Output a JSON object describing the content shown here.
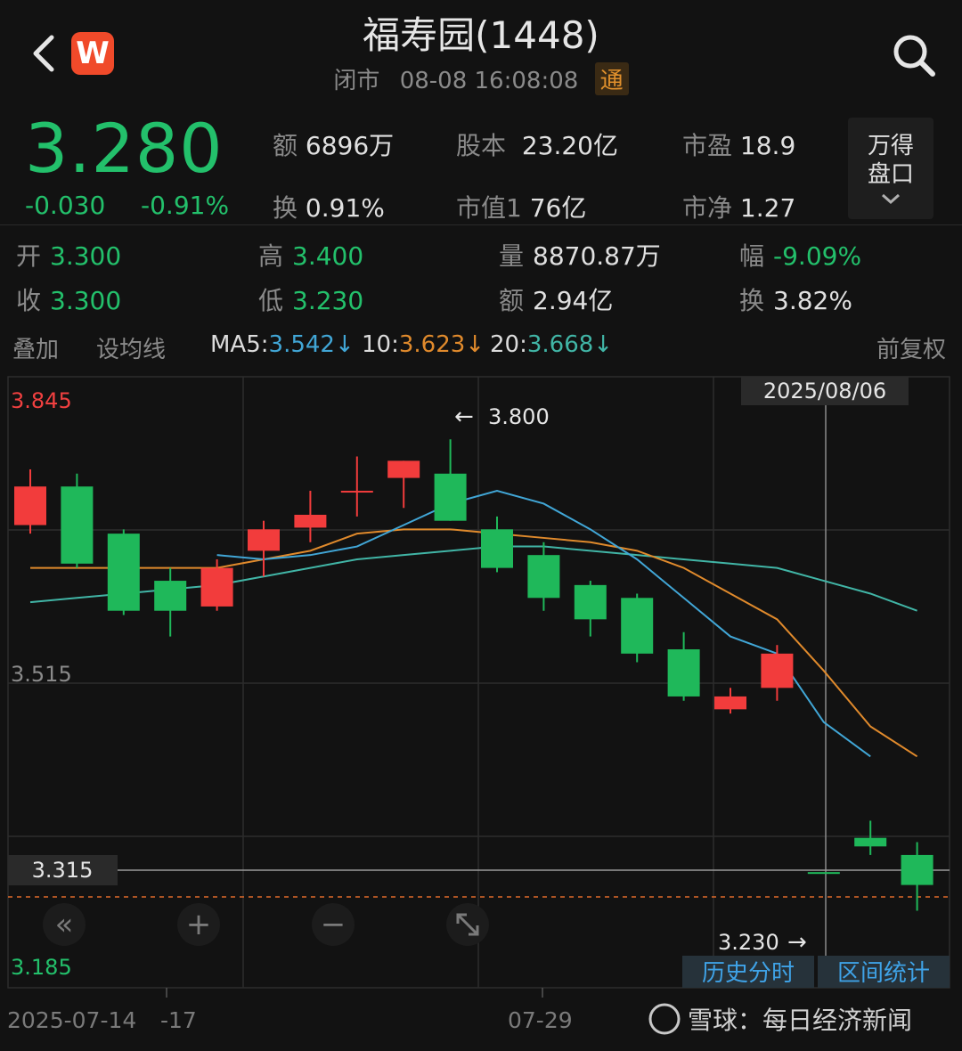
{
  "header": {
    "back_icon": "chevron-left-icon",
    "logo_letter": "W",
    "title": "福寿园(1448)",
    "status": "闭市",
    "datetime": "08-08 16:08:08",
    "badge": "通",
    "search_icon": "search-icon"
  },
  "quote": {
    "last_price": "3.280",
    "change": "-0.030",
    "change_pct": "-0.91%",
    "amount_label": "额",
    "amount": "6896万",
    "share_cap_label": "股本",
    "share_cap": "23.20亿",
    "pe_label": "市盈",
    "pe": "18.9",
    "turnover_label": "换",
    "turnover": "0.91%",
    "mkt_cap_label": "市值1",
    "mkt_cap": "76亿",
    "pb_label": "市净",
    "pb": "1.27",
    "pankou_line1": "万得",
    "pankou_line2": "盘口",
    "pankou_icon": "chevron-down-icon"
  },
  "day_stats": {
    "open_label": "开",
    "open": "3.300",
    "high_label": "高",
    "high": "3.400",
    "volume_label": "量",
    "volume": "8870.87万",
    "range_label": "幅",
    "range": "-9.09%",
    "close_label": "收",
    "close": "3.300",
    "low_label": "低",
    "low": "3.230",
    "amount_label": "额",
    "amount": "2.94亿",
    "turnover_label": "换",
    "turnover": "3.82%"
  },
  "indicators": {
    "overlay": "叠加",
    "set_ma": "设均线",
    "ma5_label": "MA5:",
    "ma5": "3.542↓",
    "ma10_label": "10:",
    "ma10": "3.623↓",
    "ma20_label": "20:",
    "ma20": "3.668↓",
    "adjust": "前复权"
  },
  "chart_controls": {
    "rewind": "«",
    "zoom_in": "+",
    "zoom_out": "−",
    "expand_icon": "expand-icon",
    "history_button": "历史分时",
    "range_stats_button": "区间统计"
  },
  "watermark": "雪球：每日经济新闻",
  "colors": {
    "up": "#f23c3c",
    "down": "#1fb85a",
    "ma5": "#41a6d6",
    "ma10": "#e08a2c",
    "ma20": "#41b5a6"
  },
  "chart_data": {
    "type": "candlestick",
    "y_tick_labels": [
      "3.845",
      "3.515",
      "3.185"
    ],
    "ylim": [
      3.185,
      3.845
    ],
    "x_tick_labels": [
      "2025-07-14",
      "-17",
      "07-29"
    ],
    "crosshair_date": "2025/08/06",
    "crosshair_price": "3.315",
    "high_annotation": "3.800",
    "low_annotation": "3.230",
    "candles": [
      {
        "open": 3.7,
        "close": 3.745,
        "high": 3.765,
        "low": 3.69
      },
      {
        "open": 3.745,
        "close": 3.655,
        "high": 3.76,
        "low": 3.65
      },
      {
        "open": 3.69,
        "close": 3.6,
        "high": 3.695,
        "low": 3.595
      },
      {
        "open": 3.635,
        "close": 3.6,
        "high": 3.65,
        "low": 3.57
      },
      {
        "open": 3.605,
        "close": 3.65,
        "high": 3.66,
        "low": 3.6
      },
      {
        "open": 3.67,
        "close": 3.695,
        "high": 3.705,
        "low": 3.64
      },
      {
        "open": 3.697,
        "close": 3.712,
        "high": 3.74,
        "low": 3.68
      },
      {
        "open": 3.74,
        "close": 3.74,
        "high": 3.78,
        "low": 3.71
      },
      {
        "open": 3.755,
        "close": 3.775,
        "high": 3.775,
        "low": 3.72
      },
      {
        "open": 3.76,
        "close": 3.705,
        "high": 3.8,
        "low": 3.705
      },
      {
        "open": 3.695,
        "close": 3.65,
        "high": 3.71,
        "low": 3.645
      },
      {
        "open": 3.665,
        "close": 3.615,
        "high": 3.68,
        "low": 3.6
      },
      {
        "open": 3.63,
        "close": 3.59,
        "high": 3.635,
        "low": 3.57
      },
      {
        "open": 3.615,
        "close": 3.55,
        "high": 3.62,
        "low": 3.54
      },
      {
        "open": 3.555,
        "close": 3.5,
        "high": 3.575,
        "low": 3.495
      },
      {
        "open": 3.485,
        "close": 3.5,
        "high": 3.51,
        "low": 3.48
      },
      {
        "open": 3.51,
        "close": 3.55,
        "high": 3.56,
        "low": 3.495
      },
      {
        "open": 3.295,
        "close": 3.295,
        "high": 3.295,
        "low": 3.295
      },
      {
        "open": 3.335,
        "close": 3.325,
        "high": 3.355,
        "low": 3.315
      },
      {
        "open": 3.315,
        "close": 3.28,
        "high": 3.33,
        "low": 3.25
      }
    ],
    "ma5": [
      null,
      null,
      null,
      null,
      3.665,
      3.66,
      3.665,
      3.675,
      3.7,
      3.725,
      3.74,
      3.725,
      3.695,
      3.66,
      3.615,
      3.57,
      3.55,
      3.47,
      3.43
    ],
    "ma10": [
      3.65,
      3.65,
      3.65,
      3.65,
      3.65,
      3.66,
      3.67,
      3.69,
      3.695,
      3.695,
      3.69,
      3.685,
      3.68,
      3.67,
      3.65,
      3.62,
      3.59,
      3.53,
      3.465,
      3.43
    ],
    "ma20": [
      3.61,
      3.615,
      3.62,
      3.625,
      3.63,
      3.64,
      3.65,
      3.66,
      3.665,
      3.67,
      3.675,
      3.675,
      3.67,
      3.665,
      3.66,
      3.655,
      3.65,
      3.635,
      3.62,
      3.6
    ]
  }
}
